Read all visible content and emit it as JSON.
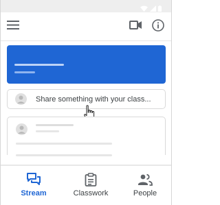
{
  "colors": {
    "accent": "#1f66d4",
    "inactive_icon": "#5f6368",
    "status_bar": "#eeeeee"
  },
  "status_bar": {
    "icons": [
      "wifi-icon",
      "signal-icon",
      "battery-icon"
    ]
  },
  "app_bar": {
    "icons": [
      "menu-icon",
      "video-camera-icon",
      "info-icon"
    ]
  },
  "share_box": {
    "placeholder": "Share something with your class..."
  },
  "bottom_nav": {
    "items": [
      {
        "label": "Stream",
        "icon": "stream-icon",
        "active": true
      },
      {
        "label": "Classwork",
        "icon": "classwork-icon",
        "active": false
      },
      {
        "label": "People",
        "icon": "people-icon",
        "active": false
      }
    ]
  }
}
